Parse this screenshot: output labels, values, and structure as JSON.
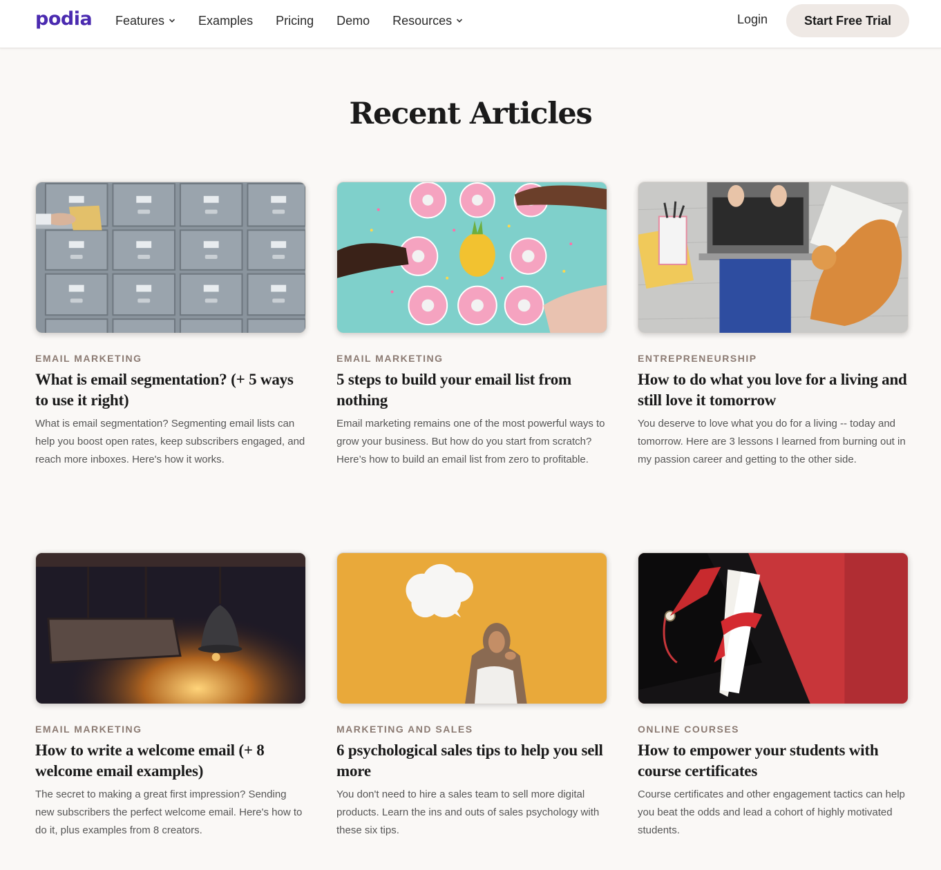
{
  "brand": {
    "name": "podia",
    "color": "#4b2bb0"
  },
  "nav": {
    "items": [
      {
        "label": "Features",
        "dropdown": true
      },
      {
        "label": "Examples",
        "dropdown": false
      },
      {
        "label": "Pricing",
        "dropdown": false
      },
      {
        "label": "Demo",
        "dropdown": false
      },
      {
        "label": "Resources",
        "dropdown": true
      }
    ],
    "login": "Login",
    "cta": "Start Free Trial"
  },
  "main": {
    "title": "Recent Articles",
    "articles": [
      {
        "image": "file-cabinet-drawers-photo",
        "category": "EMAIL MARKETING",
        "title": "What is email segmentation? (+ 5 ways to use it right)",
        "description": "What is email segmentation? Segmenting email lists can help you boost open rates, keep subscribers engaged, and reach more inboxes. Here's how it works."
      },
      {
        "image": "donuts-on-teal-photo",
        "category": "EMAIL MARKETING",
        "title": "5 steps to build your email list from nothing",
        "description": "Email marketing remains one of the most powerful ways to grow your business. But how do you start from scratch? Here’s how to build an email list from zero to profitable."
      },
      {
        "image": "laptop-and-cat-photo",
        "category": "ENTREPRENEURSHIP",
        "title": "How to do what you love for a living and still love it tomorrow",
        "description": "You deserve to love what you do for a living -- today and tomorrow. Here are 3 lessons I learned from burning out in my passion career and getting to the other side."
      },
      {
        "image": "welcome-sign-bell-photo",
        "category": "EMAIL MARKETING",
        "title": "How to write a welcome email (+ 8 welcome email examples)",
        "description": "The secret to making a great first impression? Sending new subscribers the perfect welcome email. Here's how to do it, plus examples from 8 creators."
      },
      {
        "image": "thinking-woman-speech-bubble-photo",
        "category": "MARKETING AND SALES",
        "title": "6 psychological sales tips to help you sell more",
        "description": "You don't need to hire a sales team to sell more digital products. Learn the ins and outs of sales psychology with these six tips."
      },
      {
        "image": "graduation-cap-diploma-photo",
        "category": "ONLINE COURSES",
        "title": "How to empower your students with course certificates",
        "description": "Course certificates and other engagement tactics can help you beat the odds and lead a cohort of highly motivated students."
      }
    ]
  }
}
